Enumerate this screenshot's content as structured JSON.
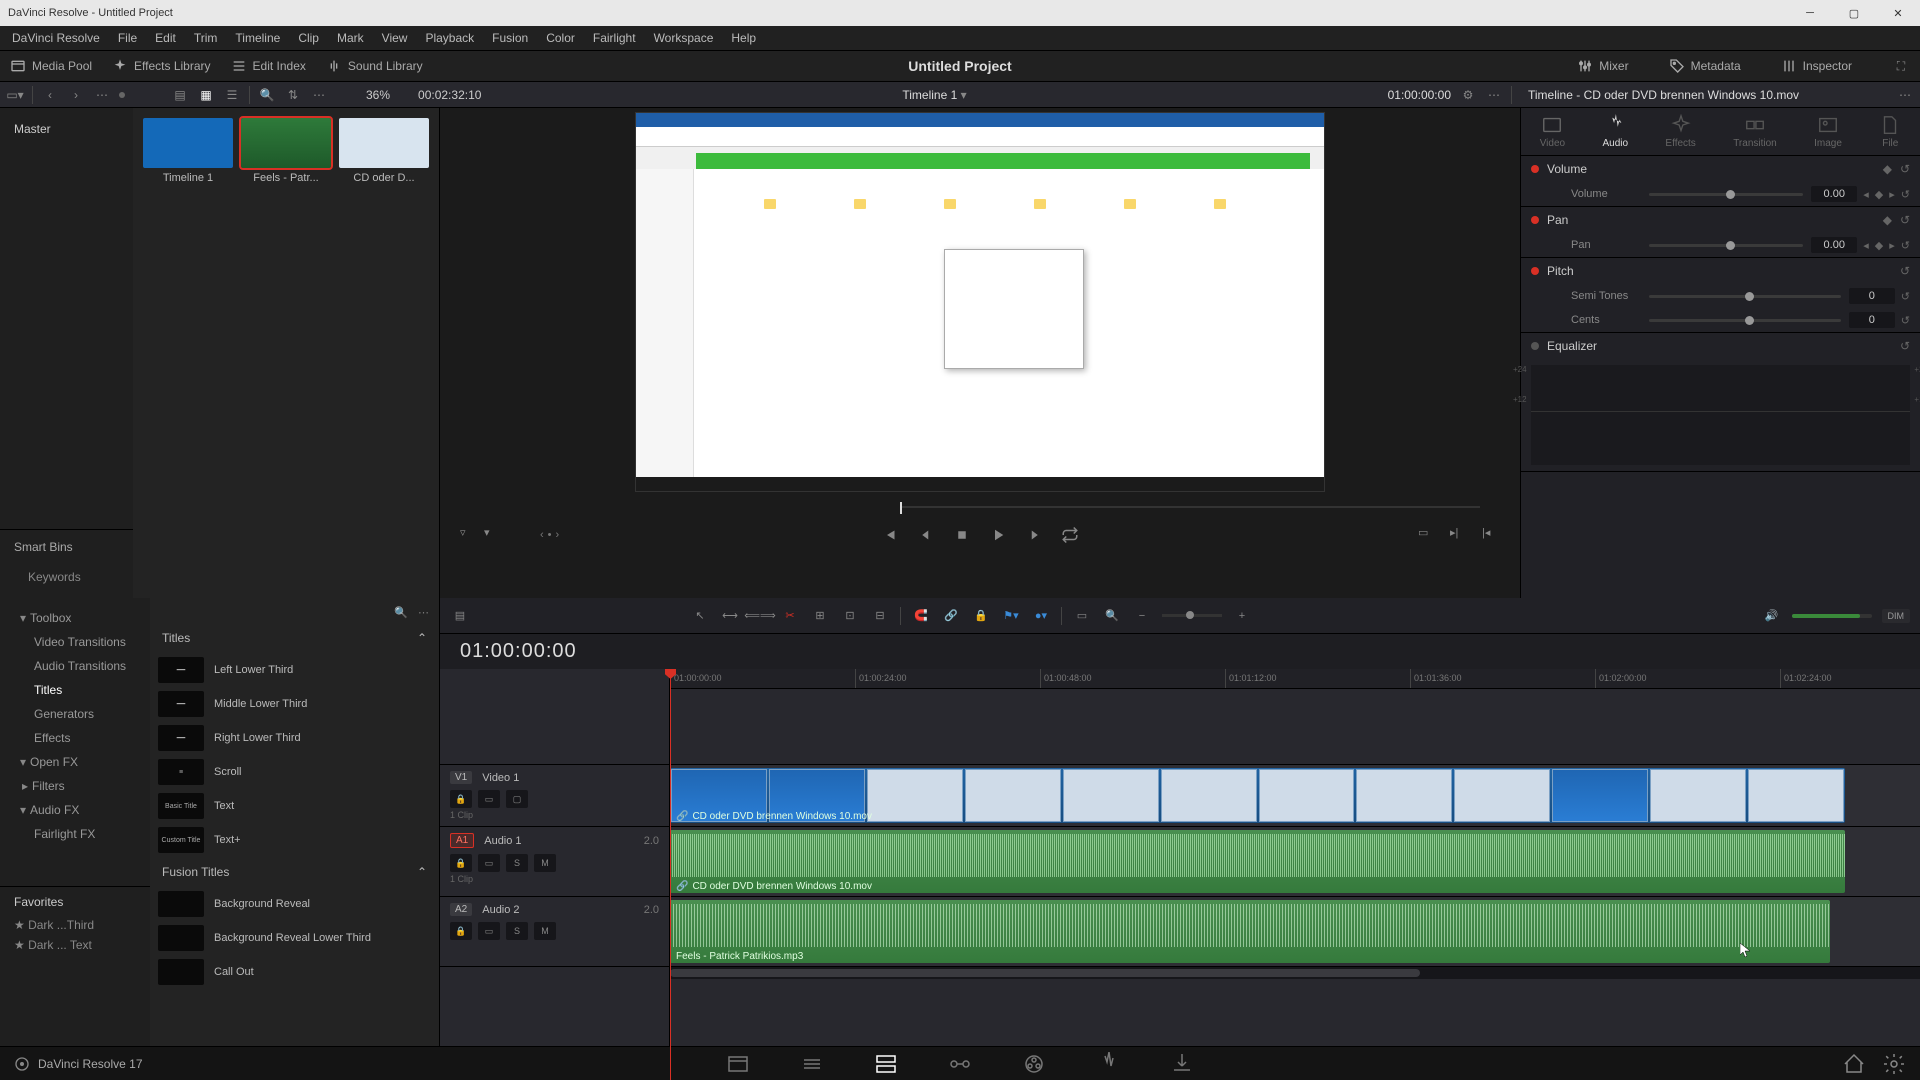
{
  "titlebar": {
    "title": "DaVinci Resolve - Untitled Project"
  },
  "menu": [
    "DaVinci Resolve",
    "File",
    "Edit",
    "Trim",
    "Timeline",
    "Clip",
    "Mark",
    "View",
    "Playback",
    "Fusion",
    "Color",
    "Fairlight",
    "Workspace",
    "Help"
  ],
  "secbar": {
    "media_pool": "Media Pool",
    "effects": "Effects Library",
    "edit_index": "Edit Index",
    "sound": "Sound Library",
    "project": "Untitled Project",
    "mixer": "Mixer",
    "metadata": "Metadata",
    "inspector": "Inspector"
  },
  "toolbar": {
    "zoom": "36%",
    "duration": "00:02:32:10",
    "timeline_name": "Timeline 1",
    "tc": "01:00:00:00"
  },
  "bins": {
    "master": "Master",
    "smartbins": "Smart Bins",
    "keywords": "Keywords"
  },
  "clips": [
    {
      "name": "Timeline 1"
    },
    {
      "name": "Feels - Patr..."
    },
    {
      "name": "CD oder D..."
    }
  ],
  "fx_tree": {
    "toolbox": "Toolbox",
    "video_trans": "Video Transitions",
    "audio_trans": "Audio Transitions",
    "titles": "Titles",
    "generators": "Generators",
    "effects": "Effects",
    "openfx": "Open FX",
    "filters": "Filters",
    "audiofx": "Audio FX",
    "fairlightfx": "Fairlight FX",
    "favorites": "Favorites",
    "fav1": "Dark ...Third",
    "fav2": "Dark ... Text"
  },
  "titles_list": {
    "header": "Titles",
    "items": [
      "Left Lower Third",
      "Middle Lower Third",
      "Right Lower Third",
      "Scroll",
      "Text",
      "Text+"
    ],
    "fusion_header": "Fusion Titles",
    "fusion_items": [
      "Background Reveal",
      "Background Reveal Lower Third",
      "Call Out"
    ],
    "thumbs": [
      "",
      "",
      "",
      "",
      "Basic Title",
      "Custom Title",
      "",
      "",
      ""
    ]
  },
  "inspector": {
    "title": "Timeline - CD oder DVD brennen Windows 10.mov",
    "tabs": {
      "video": "Video",
      "audio": "Audio",
      "effects": "Effects",
      "transition": "Transition",
      "image": "Image",
      "file": "File"
    },
    "volume": {
      "label": "Volume",
      "param": "Volume",
      "value": "0.00"
    },
    "pan": {
      "label": "Pan",
      "param": "Pan",
      "value": "0.00"
    },
    "pitch": {
      "label": "Pitch",
      "semi": "Semi Tones",
      "semi_val": "0",
      "cents": "Cents",
      "cents_val": "0"
    },
    "equalizer": {
      "label": "Equalizer"
    }
  },
  "timeline": {
    "tc": "01:00:00:00",
    "ruler": [
      "01:00:00:00",
      "01:00:24:00",
      "01:00:48:00",
      "01:01:12:00",
      "01:01:36:00",
      "01:02:00:00",
      "01:02:24:00"
    ],
    "v1": {
      "badge": "V1",
      "name": "Video 1",
      "clips_meta": "1 Clip"
    },
    "a1": {
      "badge": "A1",
      "name": "Audio 1",
      "ch": "2.0",
      "clips_meta": "1 Clip"
    },
    "a2": {
      "badge": "A2",
      "name": "Audio 2",
      "ch": "2.0"
    },
    "clip_v": "CD oder DVD brennen Windows 10.mov",
    "clip_a1": "CD oder DVD brennen Windows 10.mov",
    "clip_a2": "Feels - Patrick Patrikios.mp3"
  },
  "pagebar": {
    "version": "DaVinci Resolve 17"
  },
  "dim": "DIM"
}
